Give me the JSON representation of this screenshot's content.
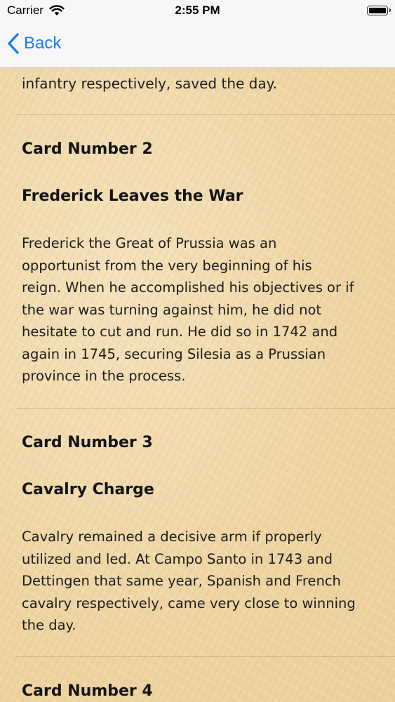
{
  "status_bar": {
    "carrier": "Carrier",
    "time": "2:55 PM"
  },
  "nav": {
    "back_label": "Back"
  },
  "previous_card_tail": "infantry respectively, saved the day.",
  "cards": [
    {
      "number_label": "Card Number 2",
      "title": "Frederick Leaves the War",
      "body_lines": [
        "Frederick the Great of Prussia was an",
        "opportunist from the very beginning of his",
        "reign. When he accomplished his objectives or if",
        "the war was turning against him, he did not",
        "hesitate to cut and run. He did so in 1742 and",
        "again in 1745, securing Silesia as a Prussian",
        "province in the process."
      ]
    },
    {
      "number_label": "Card Number 3",
      "title": "Cavalry Charge",
      "body_lines": [
        "Cavalry remained a decisive arm if properly",
        "utilized and led. At Campo Santo in 1743 and",
        "Dettingen that same year, Spanish and French",
        "cavalry respectively, came very close to winning",
        "the day."
      ]
    },
    {
      "number_label": "Card Number 4"
    }
  ]
}
